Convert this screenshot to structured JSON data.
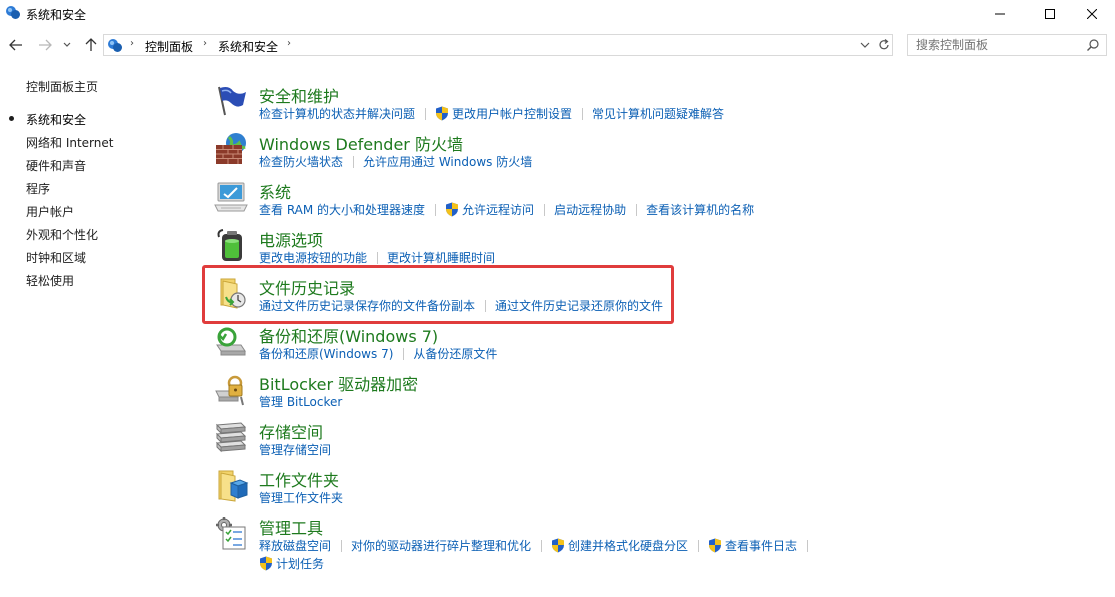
{
  "window": {
    "title": "系统和安全"
  },
  "address": {
    "breadcrumbs": [
      "控制面板",
      "系统和安全"
    ]
  },
  "search": {
    "placeholder": "搜索控制面板"
  },
  "leftnav": {
    "home": "控制面板主页",
    "items": [
      {
        "label": "系统和安全",
        "current": true
      },
      {
        "label": "网络和 Internet"
      },
      {
        "label": "硬件和声音"
      },
      {
        "label": "程序"
      },
      {
        "label": "用户帐户"
      },
      {
        "label": "外观和个性化"
      },
      {
        "label": "时钟和区域"
      },
      {
        "label": "轻松使用"
      }
    ]
  },
  "categories": [
    {
      "title": "安全和维护",
      "icon": "flag-icon",
      "links": [
        {
          "label": "检查计算机的状态并解决问题"
        },
        {
          "label": "更改用户帐户控制设置",
          "shield": true
        },
        {
          "label": "常见计算机问题疑难解答"
        }
      ]
    },
    {
      "title": "Windows Defender 防火墙",
      "icon": "firewall-icon",
      "links": [
        {
          "label": "检查防火墙状态"
        },
        {
          "label": "允许应用通过 Windows 防火墙"
        }
      ]
    },
    {
      "title": "系统",
      "icon": "computer-icon",
      "links": [
        {
          "label": "查看 RAM 的大小和处理器速度"
        },
        {
          "label": "允许远程访问",
          "shield": true
        },
        {
          "label": "启动远程协助"
        },
        {
          "label": "查看该计算机的名称"
        }
      ]
    },
    {
      "title": "电源选项",
      "icon": "battery-icon",
      "links": [
        {
          "label": "更改电源按钮的功能"
        },
        {
          "label": "更改计算机睡眠时间"
        }
      ]
    },
    {
      "title": "文件历史记录",
      "icon": "file-history-icon",
      "links": [
        {
          "label": "通过文件历史记录保存你的文件备份副本"
        },
        {
          "label": "通过文件历史记录还原你的文件"
        }
      ]
    },
    {
      "title": "备份和还原(Windows 7)",
      "icon": "backup-icon",
      "links": [
        {
          "label": "备份和还原(Windows 7)"
        },
        {
          "label": "从备份还原文件"
        }
      ]
    },
    {
      "title": "BitLocker 驱动器加密",
      "icon": "bitlocker-icon",
      "links": [
        {
          "label": "管理 BitLocker"
        }
      ]
    },
    {
      "title": "存储空间",
      "icon": "storage-icon",
      "links": [
        {
          "label": "管理存储空间"
        }
      ]
    },
    {
      "title": "工作文件夹",
      "icon": "work-folders-icon",
      "links": [
        {
          "label": "管理工作文件夹"
        }
      ]
    },
    {
      "title": "管理工具",
      "icon": "admin-tools-icon",
      "links": [
        {
          "label": "释放磁盘空间"
        },
        {
          "label": "对你的驱动器进行碎片整理和优化"
        },
        {
          "label": "创建并格式化硬盘分区",
          "shield": true
        },
        {
          "label": "查看事件日志",
          "shield": true
        }
      ],
      "links2": [
        {
          "label": "计划任务",
          "shield": true
        }
      ]
    }
  ],
  "colors": {
    "title_green": "#1e7a1e",
    "link_blue": "#0b5fb4",
    "highlight_red": "#e03c3c"
  }
}
